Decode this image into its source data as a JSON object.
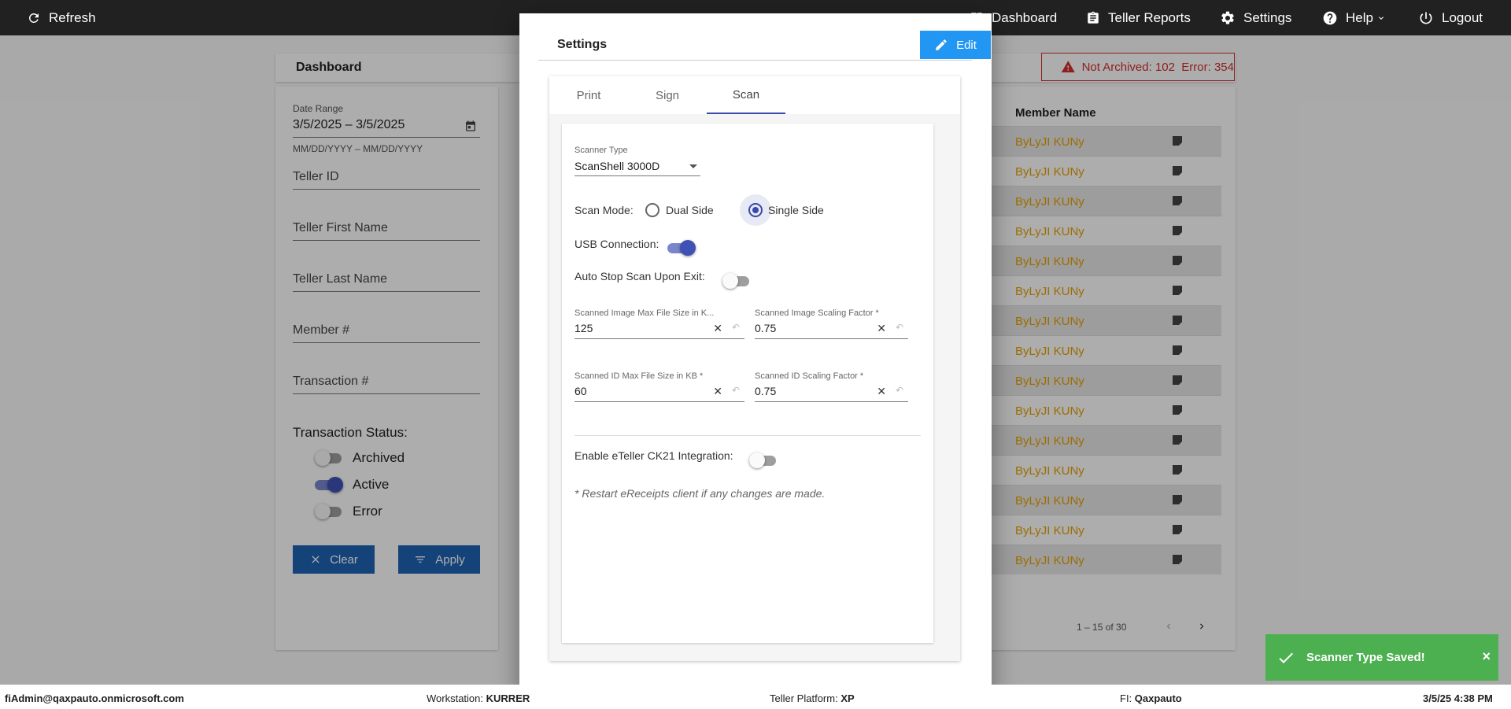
{
  "topbar": {
    "refresh": "Refresh",
    "dashboard": "Dashboard",
    "teller_reports": "Teller Reports",
    "settings": "Settings",
    "help": "Help",
    "logout": "Logout"
  },
  "page": {
    "title": "Dashboard",
    "warning": "Not Archived: 102  Error: 354"
  },
  "filters": {
    "date_range_label": "Date Range",
    "date_range_value": "3/5/2025 – 3/5/2025",
    "date_hint": "MM/DD/YYYY – MM/DD/YYYY",
    "teller_id": "Teller ID",
    "teller_first": "Teller First Name",
    "teller_last": "Teller Last Name",
    "member_num": "Member #",
    "transaction_num": "Transaction #",
    "status_title": "Transaction Status:",
    "status_archived": "Archived",
    "status_active": "Active",
    "status_error": "Error",
    "clear": "Clear",
    "apply": "Apply"
  },
  "table": {
    "header_member": "Member Name",
    "rows": [
      "ByLyJI KUNy",
      "ByLyJI KUNy",
      "ByLyJI KUNy",
      "ByLyJI KUNy",
      "ByLyJI KUNy",
      "ByLyJI KUNy",
      "ByLyJI KUNy",
      "ByLyJI KUNy",
      "ByLyJI KUNy",
      "ByLyJI KUNy",
      "ByLyJI KUNy",
      "ByLyJI KUNy",
      "ByLyJI KUNy",
      "ByLyJI KUNy",
      "ByLyJI KUNy"
    ],
    "pager": "1 – 15 of 30"
  },
  "modal": {
    "title": "Settings",
    "edit": "Edit",
    "tabs": [
      "Print",
      "Sign",
      "Scan"
    ],
    "scanner_type_label": "Scanner Type",
    "scanner_type_value": "ScanShell 3000D",
    "scan_mode_label": "Scan Mode:",
    "dual_side": "Dual Side",
    "single_side": "Single Side",
    "usb_label": "USB Connection:",
    "auto_stop_label": "Auto Stop Scan Upon Exit:",
    "img_max_label": "Scanned Image Max File Size in K...",
    "img_max_value": "125",
    "img_scale_label": "Scanned Image Scaling Factor *",
    "img_scale_value": "0.75",
    "id_max_label": "Scanned ID Max File Size in KB *",
    "id_max_value": "60",
    "id_scale_label": "Scanned ID Scaling Factor *",
    "id_scale_value": "0.75",
    "ck21_label": "Enable eTeller CK21 Integration:",
    "restart_note": "* Restart eReceipts client if any changes are made."
  },
  "toast": {
    "message": "Scanner Type Saved!",
    "close": "×"
  },
  "footer": {
    "user": "fiAdmin@qaxpauto.onmicrosoft.com",
    "workstation_label": "Workstation:",
    "workstation": "KURRER",
    "platform_label": "Teller Platform:",
    "platform": "XP",
    "fi_label": "FI:",
    "fi": "Qaxpauto",
    "datetime": "3/5/25 4:38 PM"
  }
}
